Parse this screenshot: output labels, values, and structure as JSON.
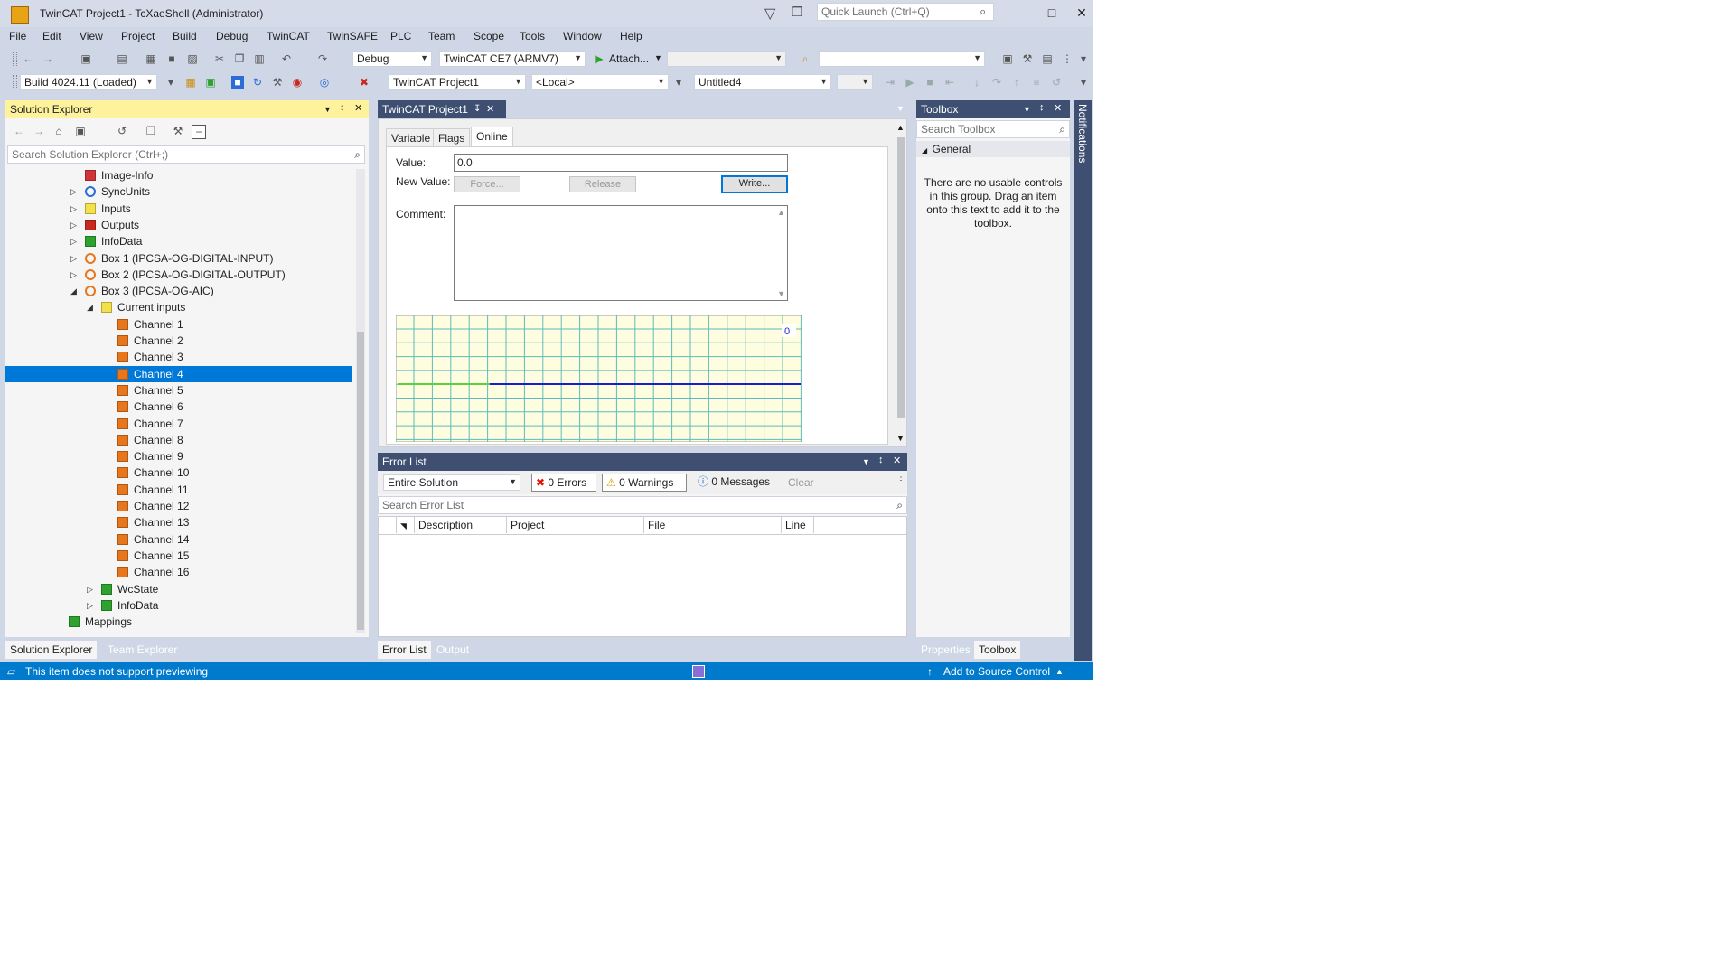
{
  "window": {
    "title": "TwinCAT Project1 - TcXaeShell (Administrator)",
    "minimize": "—",
    "maximize": "□",
    "close": "✕"
  },
  "quick_launch": {
    "placeholder": "Quick Launch (Ctrl+Q)"
  },
  "menu": [
    "File",
    "Edit",
    "View",
    "Project",
    "Build",
    "Debug",
    "TwinCAT",
    "TwinSAFE",
    "PLC",
    "Team",
    "Scope",
    "Tools",
    "Window",
    "Help"
  ],
  "toolbar1": {
    "config": "Debug",
    "platform": "TwinCAT CE7 (ARMV7)",
    "attach": "Attach...",
    "attach_target": "",
    "find_combo": ""
  },
  "toolbar2": {
    "build": "Build 4024.11 (Loaded)",
    "project": "TwinCAT Project1",
    "target": "<Local>",
    "document": "Untitled4",
    "disabled_combo": ""
  },
  "solution_explorer": {
    "title": "Solution Explorer",
    "search_placeholder": "Search Solution Explorer (Ctrl+;)",
    "tree": [
      {
        "label": "Image-Info",
        "indent": 1,
        "expander": "",
        "icon": "image-info",
        "color": "#d13438"
      },
      {
        "label": "SyncUnits",
        "indent": 1,
        "expander": "▷",
        "icon": "sync",
        "color": "#2b6cd6"
      },
      {
        "label": "Inputs",
        "indent": 1,
        "expander": "▷",
        "icon": "folder",
        "color": "#f3e04a"
      },
      {
        "label": "Outputs",
        "indent": 1,
        "expander": "▷",
        "icon": "folder",
        "color": "#c8281e"
      },
      {
        "label": "InfoData",
        "indent": 1,
        "expander": "▷",
        "icon": "folder",
        "color": "#2ea12e"
      },
      {
        "label": "Box 1 (IPCSA-OG-DIGITAL-INPUT)",
        "indent": 1,
        "expander": "▷",
        "icon": "box",
        "color": "#e8761c"
      },
      {
        "label": "Box 2 (IPCSA-OG-DIGITAL-OUTPUT)",
        "indent": 1,
        "expander": "▷",
        "icon": "box",
        "color": "#e8761c"
      },
      {
        "label": "Box 3 (IPCSA-OG-AIC)",
        "indent": 1,
        "expander": "◢",
        "icon": "box",
        "color": "#e8761c"
      },
      {
        "label": "Current inputs",
        "indent": 2,
        "expander": "◢",
        "icon": "folder",
        "color": "#f3e04a"
      },
      {
        "label": "Channel 1",
        "indent": 3,
        "expander": "",
        "icon": "channel",
        "color": "#e8761c"
      },
      {
        "label": "Channel 2",
        "indent": 3,
        "expander": "",
        "icon": "channel",
        "color": "#e8761c"
      },
      {
        "label": "Channel 3",
        "indent": 3,
        "expander": "",
        "icon": "channel",
        "color": "#e8761c"
      },
      {
        "label": "Channel 4",
        "indent": 3,
        "expander": "",
        "icon": "channel",
        "color": "#e8761c",
        "selected": true
      },
      {
        "label": "Channel 5",
        "indent": 3,
        "expander": "",
        "icon": "channel",
        "color": "#e8761c"
      },
      {
        "label": "Channel 6",
        "indent": 3,
        "expander": "",
        "icon": "channel",
        "color": "#e8761c"
      },
      {
        "label": "Channel 7",
        "indent": 3,
        "expander": "",
        "icon": "channel",
        "color": "#e8761c"
      },
      {
        "label": "Channel 8",
        "indent": 3,
        "expander": "",
        "icon": "channel",
        "color": "#e8761c"
      },
      {
        "label": "Channel 9",
        "indent": 3,
        "expander": "",
        "icon": "channel",
        "color": "#e8761c"
      },
      {
        "label": "Channel 10",
        "indent": 3,
        "expander": "",
        "icon": "channel",
        "color": "#e8761c"
      },
      {
        "label": "Channel 11",
        "indent": 3,
        "expander": "",
        "icon": "channel",
        "color": "#e8761c"
      },
      {
        "label": "Channel 12",
        "indent": 3,
        "expander": "",
        "icon": "channel",
        "color": "#e8761c"
      },
      {
        "label": "Channel 13",
        "indent": 3,
        "expander": "",
        "icon": "channel",
        "color": "#e8761c"
      },
      {
        "label": "Channel 14",
        "indent": 3,
        "expander": "",
        "icon": "channel",
        "color": "#e8761c"
      },
      {
        "label": "Channel 15",
        "indent": 3,
        "expander": "",
        "icon": "channel",
        "color": "#e8761c"
      },
      {
        "label": "Channel 16",
        "indent": 3,
        "expander": "",
        "icon": "channel",
        "color": "#e8761c"
      },
      {
        "label": "WcState",
        "indent": 2,
        "expander": "▷",
        "icon": "folder",
        "color": "#2ea12e"
      },
      {
        "label": "InfoData",
        "indent": 2,
        "expander": "▷",
        "icon": "folder",
        "color": "#2ea12e"
      },
      {
        "label": "Mappings",
        "indent": 0,
        "expander": "",
        "icon": "mappings",
        "color": "#2ea12e"
      }
    ],
    "tabs": [
      "Solution Explorer",
      "Team Explorer"
    ]
  },
  "doc": {
    "tab_title": "TwinCAT Project1",
    "subtabs": [
      "Variable",
      "Flags",
      "Online"
    ],
    "value_label": "Value:",
    "value": "0.0",
    "new_value_label": "New Value:",
    "force_label": "Force...",
    "release_label": "Release",
    "write_label": "Write...",
    "comment_label": "Comment:",
    "chart_marker": "0"
  },
  "error_list": {
    "title": "Error List",
    "scope": "Entire Solution",
    "errors": "0 Errors",
    "warnings": "0 Warnings",
    "messages": "0 Messages",
    "clear": "Clear",
    "search_placeholder": "Search Error List",
    "columns": [
      "Description",
      "Project",
      "File",
      "Line"
    ],
    "tabs": [
      "Error List",
      "Output"
    ]
  },
  "toolbox": {
    "title": "Toolbox",
    "search_placeholder": "Search Toolbox",
    "group": "General",
    "empty_text": "There are no usable controls in this group. Drag an item onto this text to add it to the toolbox.",
    "tabs": [
      "Properties",
      "Toolbox"
    ]
  },
  "notifications": {
    "label": "Notifications"
  },
  "status": {
    "text": "This item does not support previewing",
    "source_control": "Add to Source Control"
  },
  "colors": {
    "accent": "#007acc",
    "selection": "#0078d7",
    "active_title": "#fff29d",
    "chrome": "#cfd6e5"
  }
}
